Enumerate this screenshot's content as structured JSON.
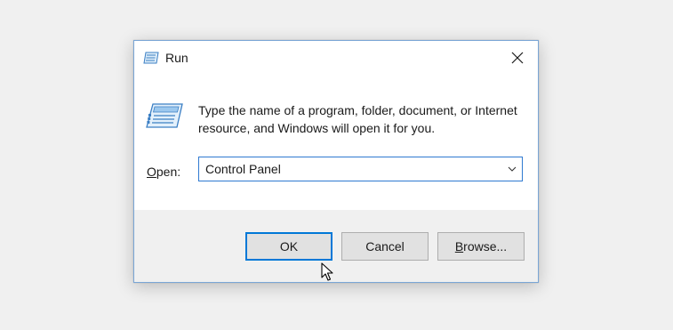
{
  "dialog": {
    "title": "Run",
    "description": "Type the name of a program, folder, document, or Internet resource, and Windows will open it for you.",
    "open_label_prefix": "O",
    "open_label_rest": "pen:",
    "open_value": "Control Panel",
    "buttons": {
      "ok": "OK",
      "cancel": "Cancel",
      "browse_prefix": "B",
      "browse_rest": "rowse..."
    }
  },
  "icons": {
    "title": "run-icon",
    "close": "close-icon",
    "dropdown": "chevron-down-icon",
    "cursor": "mouse-pointer-icon"
  },
  "colors": {
    "accent": "#0078d7",
    "background": "#f0f0f0",
    "window_border": "#7aa6d6"
  }
}
